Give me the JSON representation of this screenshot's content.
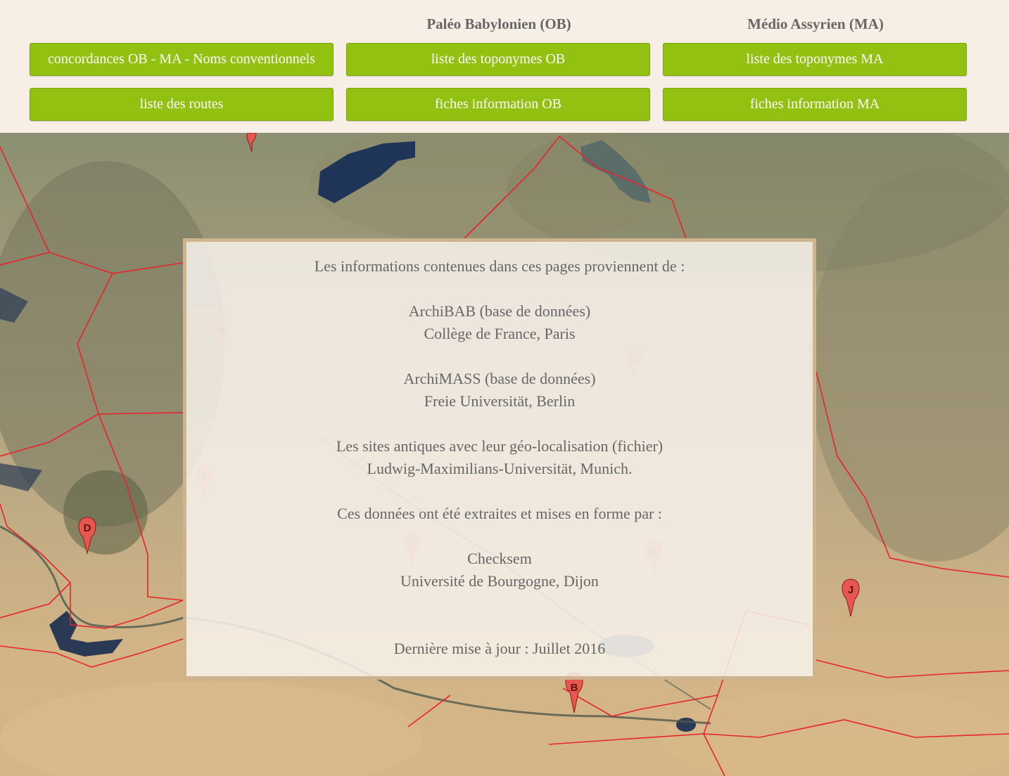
{
  "header": {
    "ob_heading": "Paléo Babylonien (OB)",
    "ma_heading": "Médio Assyrien (MA)",
    "buttons": {
      "concordances": "concordances OB - MA - Noms conventionnels",
      "toponymes_ob": "liste des toponymes OB",
      "toponymes_ma": "liste des toponymes MA",
      "routes": "liste des routes",
      "fiches_ob": "fiches information OB",
      "fiches_ma": "fiches information MA"
    }
  },
  "map": {
    "markers": [
      "D",
      "J",
      "B",
      "N",
      "H",
      "E",
      "F",
      "G"
    ],
    "marker_color": "#e8574f",
    "boundary_color": "#e8232a"
  },
  "info": {
    "intro": "Les informations contenues dans ces pages proviennent de :",
    "source1_name": "ArchiBAB (base de données)",
    "source1_org": "Collège de France, Paris",
    "source2_name": "ArchiMASS (base de données)",
    "source2_org": "Freie Universität, Berlin",
    "source3_name": "Les sites antiques avec leur géo-localisation (fichier)",
    "source3_org": "Ludwig-Maximilians-Universität, Munich.",
    "extracted_by": "Ces données ont été extraites et mises en forme par :",
    "author_name": "Checksem",
    "author_org": "Université de Bourgogne, Dijon",
    "last_update": "Dernière mise à jour : Juillet 2016"
  }
}
